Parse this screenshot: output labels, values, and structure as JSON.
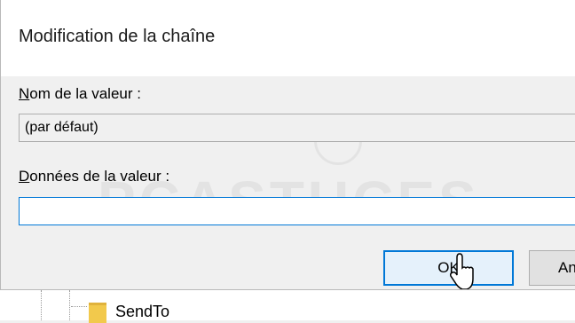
{
  "dialog": {
    "title": "Modification de la chaîne",
    "value_name_label": "Nom de la valeur :",
    "value_name_accelerator": "N",
    "value_name_rest": "om de la valeur :",
    "value_name": "(par défaut)",
    "value_data_label": "Données de la valeur :",
    "value_data_accelerator": "D",
    "value_data_rest": "onnées de la valeur :",
    "value_data": "",
    "ok_label": "OK",
    "cancel_label": "An"
  },
  "background": {
    "tree_item": "SendTo",
    "watermark": "PCASTUCES"
  },
  "colors": {
    "accent": "#0078d7",
    "dialog_bg": "#f0f0f0",
    "title_bg": "#ffffff"
  }
}
